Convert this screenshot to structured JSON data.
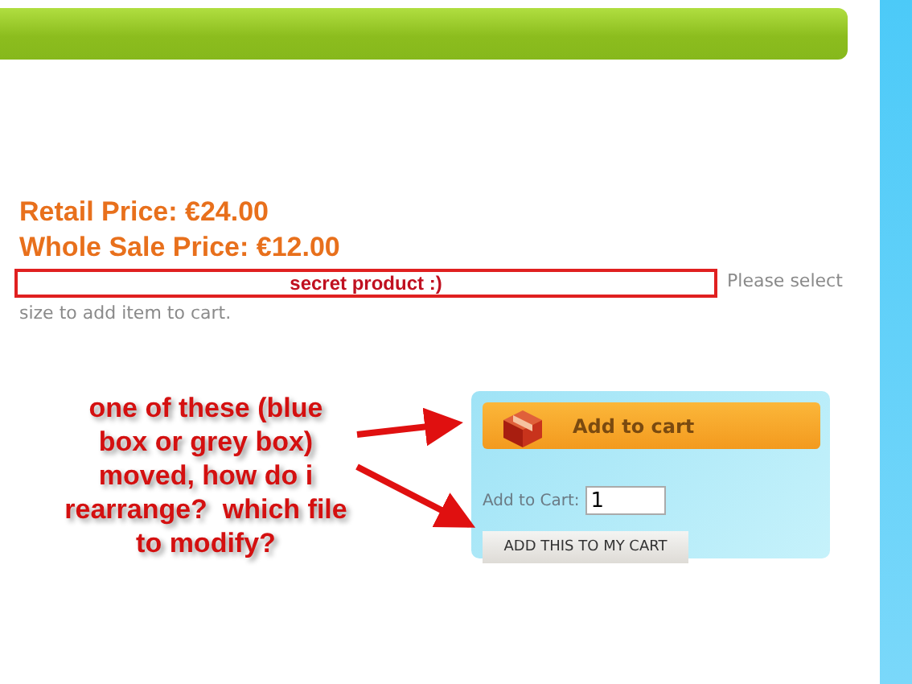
{
  "prices": [
    {
      "label": "Retail Price: €24.00"
    },
    {
      "label": "Whole Sale Price: €12.00"
    }
  ],
  "notice": {
    "text": "secret product :)"
  },
  "hint": [
    "Please select",
    "size to add item to cart."
  ],
  "annotation": "one of these (blue box or grey box) moved, how do i rearrange?  which file to modify?",
  "cart": {
    "add_button": "Add to cart",
    "quantity_label": "Add to Cart:",
    "quantity": "1",
    "submit_button": "ADD THIS TO MY CART"
  }
}
